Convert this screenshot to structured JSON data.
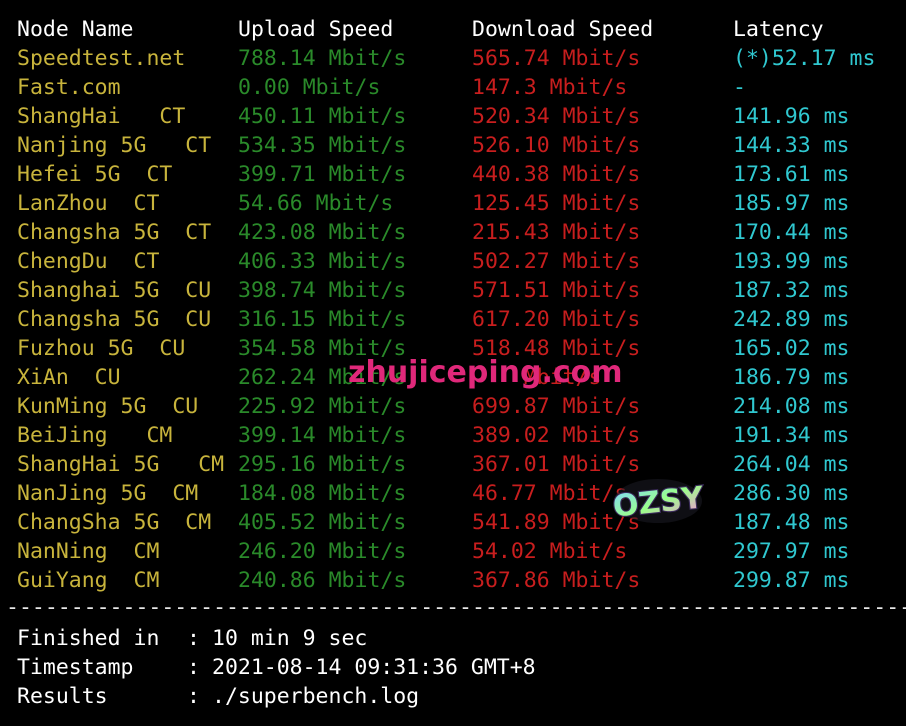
{
  "table": {
    "headers": {
      "node": "Node Name",
      "upload": "Upload Speed",
      "download": "Download Speed",
      "latency": "Latency"
    },
    "rows": [
      {
        "node": "Speedtest.net",
        "upload": "788.14 Mbit/s",
        "download": "565.74 Mbit/s",
        "latency": "(*)52.17 ms"
      },
      {
        "node": "Fast.com",
        "upload": "0.00 Mbit/s",
        "download": "147.3 Mbit/s",
        "latency": "-"
      },
      {
        "node": "ShangHai   CT",
        "upload": "450.11 Mbit/s",
        "download": "520.34 Mbit/s",
        "latency": "141.96 ms"
      },
      {
        "node": "Nanjing 5G   CT",
        "upload": "534.35 Mbit/s",
        "download": "526.10 Mbit/s",
        "latency": "144.33 ms"
      },
      {
        "node": "Hefei 5G  CT",
        "upload": "399.71 Mbit/s",
        "download": "440.38 Mbit/s",
        "latency": "173.61 ms"
      },
      {
        "node": "LanZhou  CT",
        "upload": "54.66 Mbit/s",
        "download": "125.45 Mbit/s",
        "latency": "185.97 ms"
      },
      {
        "node": "Changsha 5G  CT",
        "upload": "423.08 Mbit/s",
        "download": "215.43 Mbit/s",
        "latency": "170.44 ms"
      },
      {
        "node": "ChengDu  CT",
        "upload": "406.33 Mbit/s",
        "download": "502.27 Mbit/s",
        "latency": "193.99 ms"
      },
      {
        "node": "Shanghai 5G  CU",
        "upload": "398.74 Mbit/s",
        "download": "571.51 Mbit/s",
        "latency": "187.32 ms"
      },
      {
        "node": "Changsha 5G  CU",
        "upload": "316.15 Mbit/s",
        "download": "617.20 Mbit/s",
        "latency": "242.89 ms"
      },
      {
        "node": "Fuzhou 5G  CU",
        "upload": "354.58 Mbit/s",
        "download": "518.48 Mbit/s",
        "latency": "165.02 ms"
      },
      {
        "node": "XiAn  CU",
        "upload": "262.24 Mbit/s",
        "download": "    Mbit/s",
        "latency": "186.79 ms"
      },
      {
        "node": "KunMing 5G  CU",
        "upload": "225.92 Mbit/s",
        "download": "699.87 Mbit/s",
        "latency": "214.08 ms"
      },
      {
        "node": "BeiJing   CM",
        "upload": "399.14 Mbit/s",
        "download": "389.02 Mbit/s",
        "latency": "191.34 ms"
      },
      {
        "node": "ShangHai 5G   CM",
        "upload": "295.16 Mbit/s",
        "download": "367.01 Mbit/s",
        "latency": "264.04 ms"
      },
      {
        "node": "NanJing 5G  CM",
        "upload": "184.08 Mbit/s",
        "download": "46.77 Mbit/s",
        "latency": "286.30 ms"
      },
      {
        "node": "ChangSha 5G  CM",
        "upload": "405.52 Mbit/s",
        "download": "541.89 Mbit/s",
        "latency": "187.48 ms"
      },
      {
        "node": "NanNing  CM",
        "upload": "246.20 Mbit/s",
        "download": "54.02 Mbit/s",
        "latency": "297.97 ms"
      },
      {
        "node": "GuiYang  CM",
        "upload": "240.86 Mbit/s",
        "download": "367.86 Mbit/s",
        "latency": "299.87 ms"
      }
    ]
  },
  "divider": "------------------------------------------------------------------------",
  "summary": [
    {
      "label": "Finished in",
      "colon": ":",
      "value": "10 min 9 sec"
    },
    {
      "label": "Timestamp",
      "colon": ":",
      "value": "2021-08-14 09:31:36 GMT+8"
    },
    {
      "label": "Results",
      "colon": ":",
      "value": "./superbench.log"
    }
  ],
  "watermark": {
    "text": "zhujiceping.com",
    "color": "#e0287a"
  },
  "logo": {
    "text": "OZSY"
  },
  "colors": {
    "background": "#000000",
    "node_name": "#c8b43c",
    "upload": "#2a8a2a",
    "download": "#c81e1e",
    "latency": "#30c8d0",
    "header": "#ffffff"
  }
}
